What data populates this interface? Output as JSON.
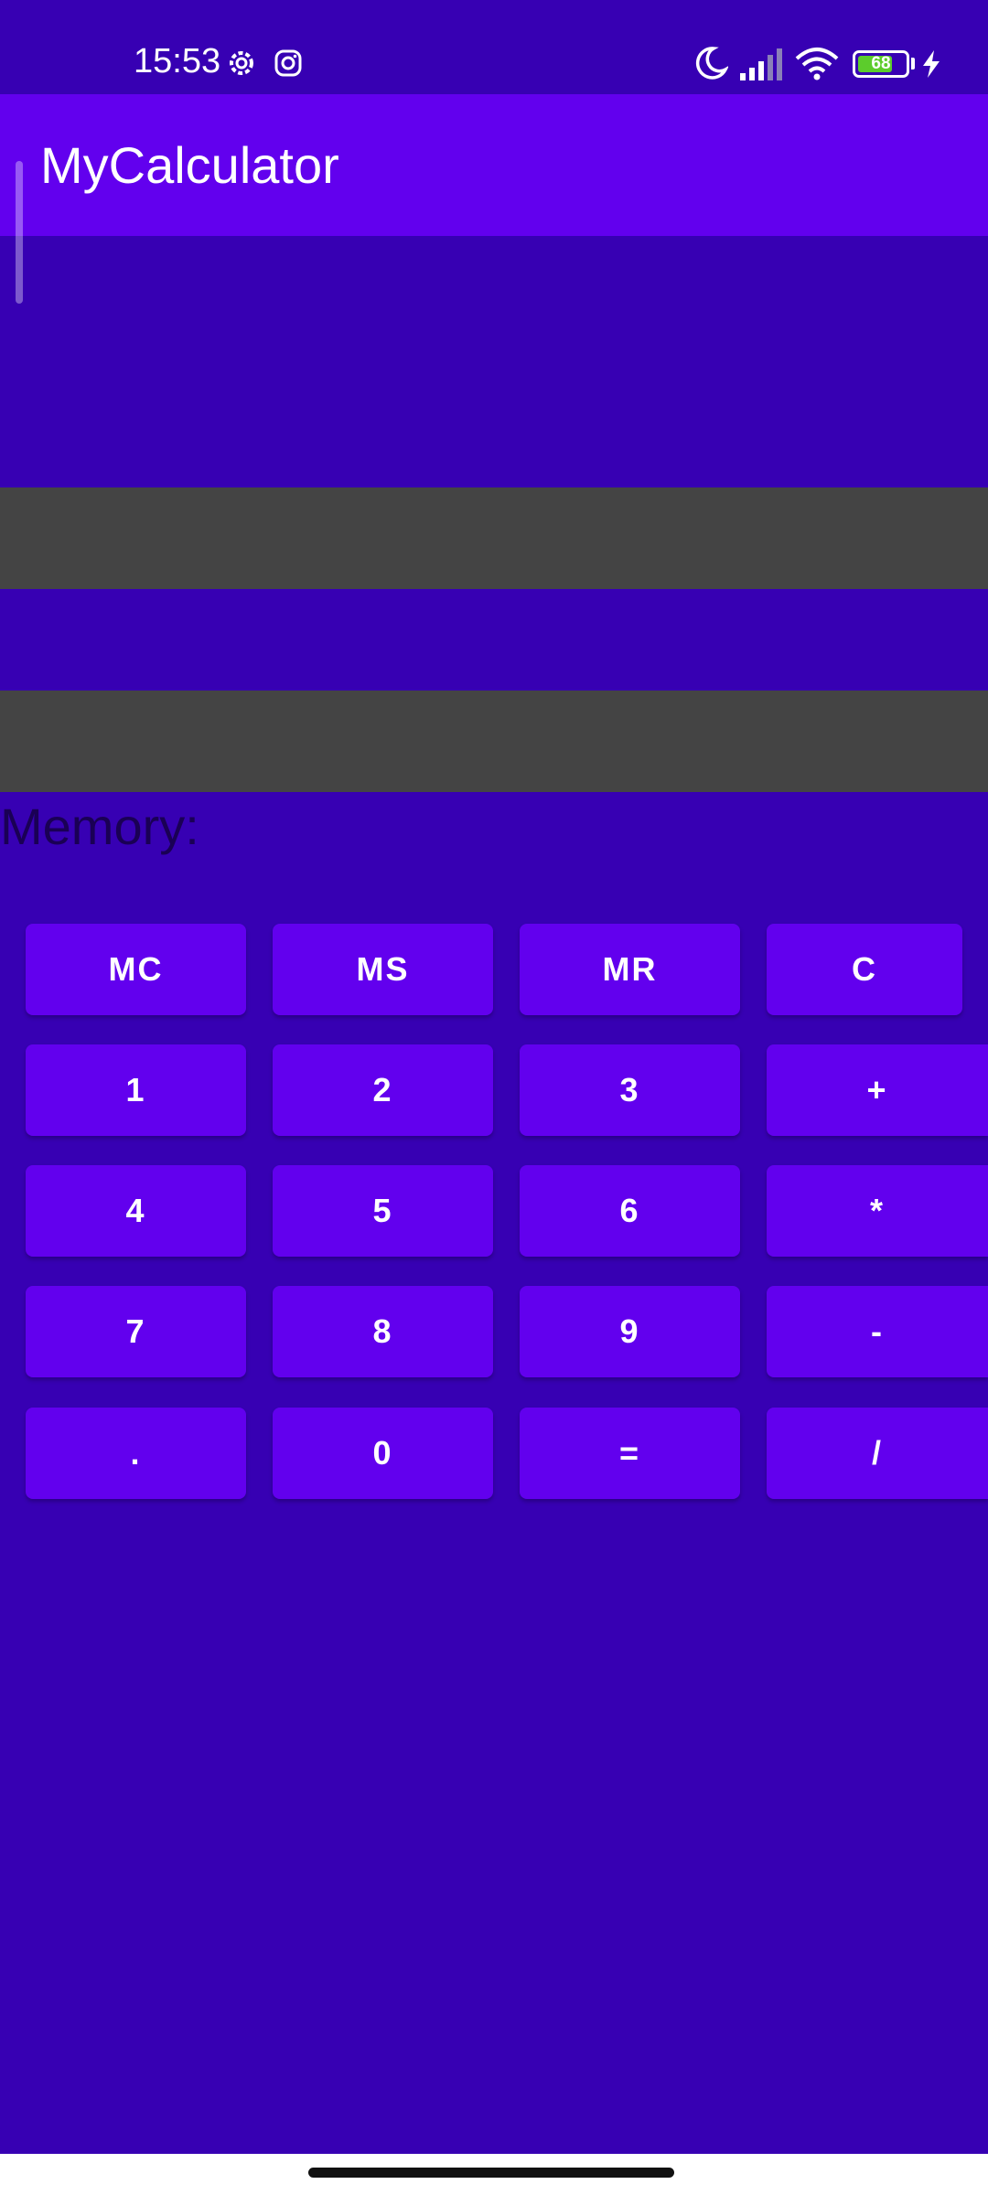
{
  "status_bar": {
    "time": "15:53",
    "battery": "68",
    "icons": [
      "settings-gear-icon",
      "instagram-icon",
      "moon-icon",
      "signal-icon",
      "wifi-icon",
      "battery-icon",
      "charging-icon"
    ]
  },
  "app_bar": {
    "title": "MyCalculator"
  },
  "display": {
    "input_value": "",
    "result_value": ""
  },
  "memory": {
    "label": "Memory:"
  },
  "keypad": {
    "rows": [
      [
        "MC",
        "MS",
        "MR",
        "C"
      ],
      [
        "1",
        "2",
        "3",
        "+"
      ],
      [
        "4",
        "5",
        "6",
        "*"
      ],
      [
        "7",
        "8",
        "9",
        "-"
      ],
      [
        ".",
        "0",
        "=",
        "/"
      ]
    ]
  },
  "colors": {
    "background": "#3700B3",
    "primary": "#6200EE",
    "display_field": "#444444"
  }
}
